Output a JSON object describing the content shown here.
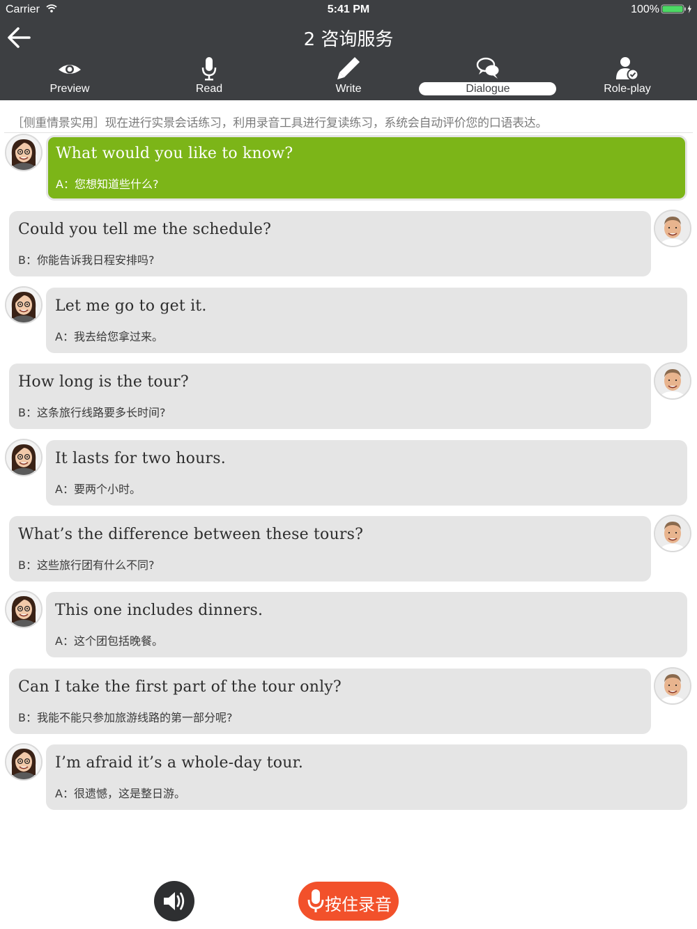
{
  "status_bar": {
    "carrier": "Carrier",
    "time": "5:41 PM",
    "battery": "100%"
  },
  "header": {
    "title": "2 咨询服务"
  },
  "tabs": [
    {
      "label": "Preview",
      "icon": "eye-icon"
    },
    {
      "label": "Read",
      "icon": "microphone-icon"
    },
    {
      "label": "Write",
      "icon": "pencil-icon"
    },
    {
      "label": "Dialogue",
      "icon": "chat-bubbles-icon",
      "active": true
    },
    {
      "label": "Role-play",
      "icon": "user-check-icon"
    }
  ],
  "intro": "［侧重情景实用］现在进行实景会话练习，利用录音工具进行复读练习，系统会自动评价您的口语表达。",
  "dialogue": [
    {
      "speaker": "A",
      "en": "What would you like to know?",
      "zh": "A：您想知道些什么?"
    },
    {
      "speaker": "B",
      "en": "Could you tell me the schedule?",
      "zh": "B：你能告诉我日程安排吗?"
    },
    {
      "speaker": "A",
      "en": "Let me go to get it.",
      "zh": "A：我去给您拿过来。"
    },
    {
      "speaker": "B",
      "en": "How long is the tour?",
      "zh": "B：这条旅行线路要多长时间?"
    },
    {
      "speaker": "A",
      "en": "It lasts for two hours.",
      "zh": "A：要两个小时。"
    },
    {
      "speaker": "B",
      "en": "What’s the difference between these tours?",
      "zh": "B：这些旅行团有什么不同?"
    },
    {
      "speaker": "A",
      "en": "This one includes dinners.",
      "zh": "A：这个团包括晚餐。"
    },
    {
      "speaker": "B",
      "en": "Can I take the first part of the tour only?",
      "zh": "B：我能不能只参加旅游线路的第一部分呢?"
    },
    {
      "speaker": "A",
      "en": "I’m afraid it’s a whole-day tour.",
      "zh": "A：很遗憾，这是整日游。"
    }
  ],
  "controls": {
    "speaker_icon": "speaker-icon",
    "record_label": "按住录音",
    "record_icon": "microphone-icon"
  },
  "colors": {
    "header_bg": "#3d3f42",
    "active_bubble": "#7cb518",
    "bubble": "#e5e5e5",
    "record_button": "#f2512b"
  }
}
